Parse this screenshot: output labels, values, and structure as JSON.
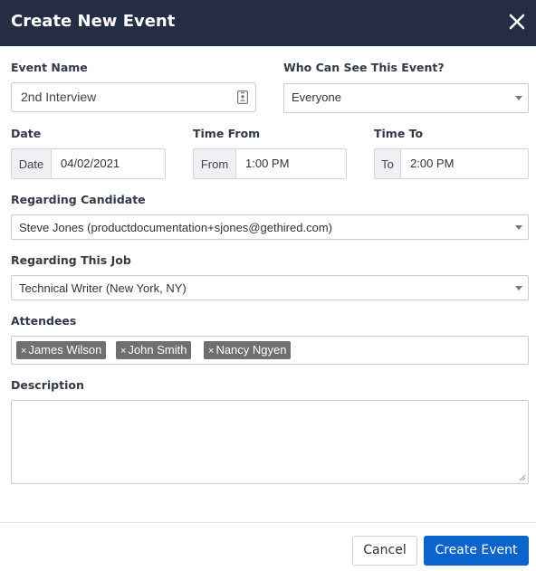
{
  "dialog": {
    "title": "Create New Event",
    "close_icon": "close-icon"
  },
  "event_name": {
    "label": "Event Name",
    "value": "2nd Interview",
    "icon": "contact-card-icon"
  },
  "visibility": {
    "label": "Who Can See This Event?",
    "selected": "Everyone"
  },
  "date": {
    "label": "Date",
    "addon": "Date",
    "value": "04/02/2021"
  },
  "time_from": {
    "label": "Time From",
    "addon": "From",
    "value": "1:00 PM"
  },
  "time_to": {
    "label": "Time To",
    "addon": "To",
    "value": "2:00 PM"
  },
  "candidate": {
    "label": "Regarding Candidate",
    "selected": "Steve Jones (productdocumentation+sjones@gethired.com)"
  },
  "job": {
    "label": "Regarding This Job",
    "selected": "Technical Writer (New York, NY)"
  },
  "attendees": {
    "label": "Attendees",
    "remove_glyph": "×",
    "items": [
      "James Wilson",
      "John Smith",
      "Nancy Ngyen"
    ]
  },
  "description": {
    "label": "Description",
    "value": ""
  },
  "footer": {
    "cancel_label": "Cancel",
    "create_label": "Create Event"
  },
  "colors": {
    "header_bg": "#252d45",
    "primary": "#0b64cb",
    "tag_bg": "#6f6f6f"
  }
}
